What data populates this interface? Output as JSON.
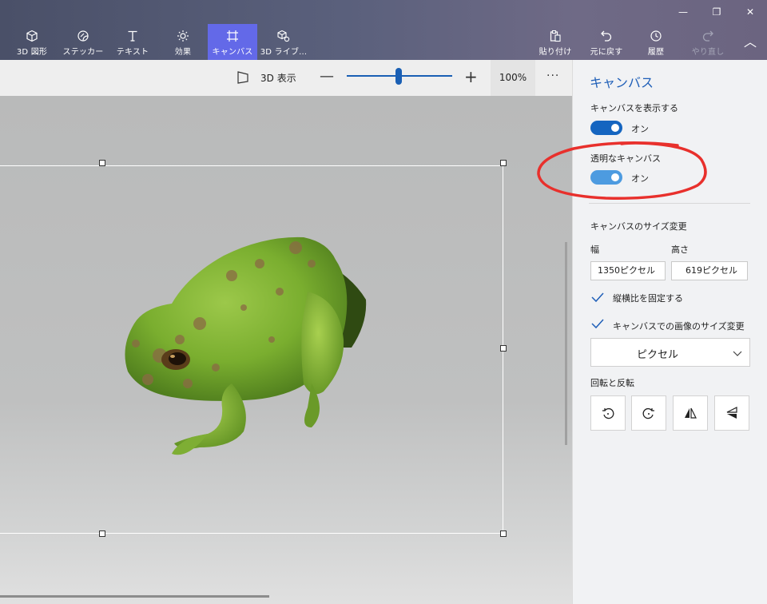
{
  "window_controls": {
    "minimize": "—",
    "restore": "❐",
    "close": "✕"
  },
  "ribbon": {
    "tools": [
      {
        "label": "3D 図形",
        "icon": "cube-icon"
      },
      {
        "label": "ステッカー",
        "icon": "sticker-icon"
      },
      {
        "label": "テキスト",
        "icon": "text-icon"
      },
      {
        "label": "効果",
        "icon": "effects-sun-icon"
      },
      {
        "label": "キャンバス",
        "icon": "canvas-icon"
      },
      {
        "label": "3D ライブ...",
        "icon": "3d-library-icon"
      }
    ],
    "actions": [
      {
        "label": "貼り付け",
        "icon": "paste-icon"
      },
      {
        "label": "元に戻す",
        "icon": "undo-icon"
      },
      {
        "label": "履歴",
        "icon": "history-icon"
      },
      {
        "label": "やり直し",
        "icon": "redo-icon"
      }
    ],
    "collapse_glyph": "︿"
  },
  "toolbar": {
    "view3d_label": "3D 表示",
    "zoom_minus": "—",
    "zoom_plus": "+",
    "zoom_percent": 100,
    "zoom_label": "100%",
    "more": "···"
  },
  "panel": {
    "title": "キャンバス",
    "show_canvas_label": "キャンバスを表示する",
    "show_canvas_state": "オン",
    "transparent_label": "透明なキャンバス",
    "transparent_state": "オン",
    "resize_heading": "キャンバスのサイズ変更",
    "width_label": "幅",
    "height_label": "高さ",
    "width_value": "1350ピクセル",
    "height_value": "619ピクセル",
    "lock_aspect_label": "縦横比を固定する",
    "resize_image_label": "キャンバスでの画像のサイズ変更",
    "unit_select": "ピクセル",
    "rotate_heading": "回転と反転"
  },
  "colors": {
    "accent": "#1f5fb8",
    "toggle_on": "#1565c0",
    "toggle_on_light": "#4d9be0",
    "active_tool": "#6369e8",
    "annotation": "#e8302c"
  }
}
